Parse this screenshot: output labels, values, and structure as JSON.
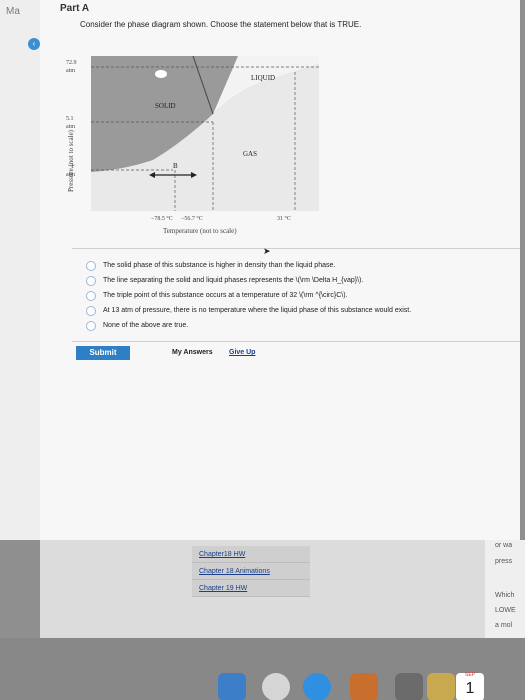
{
  "sidebar": {
    "ma": "Ma",
    "back_icon": "chevron-left-icon"
  },
  "part": {
    "title": "Part A"
  },
  "question": "Consider the phase diagram shown. Choose the statement below that is TRUE.",
  "diagram": {
    "y_axis_label": "Pressure (not to scale)",
    "x_axis_label": "Temperature (not to scale)",
    "y_ticks": [
      {
        "value": "72.9",
        "unit": "atm"
      },
      {
        "value": "5.1",
        "unit": "atm"
      },
      {
        "value": "1",
        "unit": "atm"
      }
    ],
    "x_ticks": [
      "−78.5 °C",
      "−56.7 °C",
      "31 °C"
    ],
    "regions": {
      "liquid": "LIQUID",
      "solid": "SOLID",
      "gas": "GAS"
    },
    "point_label": "B"
  },
  "options": [
    "The solid phase of this substance is higher in density than the liquid phase.",
    "The line separating the solid and liquid phases represents the \\(\\rm \\Delta H_{vap}\\).",
    "The triple point of this substance occurs at a temperature of 32 \\(\\rm ^{\\circ}C\\).",
    "At 13 atm of pressure, there is no temperature where the liquid phase of this substance would exist.",
    "None of the above are true."
  ],
  "actions": {
    "submit_label": "Submit",
    "my_answers_label": "My Answers",
    "give_up_label": "Give Up"
  },
  "chapters": [
    "Chapter18 HW",
    "Chapter 18 Animations",
    "Chapter 19 HW"
  ],
  "right_snippets": [
    "or wa",
    "press",
    "Which",
    "LOWE",
    "a mol"
  ],
  "dock": {
    "icons": [
      "finder-icon",
      "launchpad-icon",
      "safari-icon",
      "preview-icon",
      "app-icon",
      "notes-icon",
      "calendar-icon"
    ],
    "calendar_month": "SEP",
    "calendar_day": "1"
  }
}
